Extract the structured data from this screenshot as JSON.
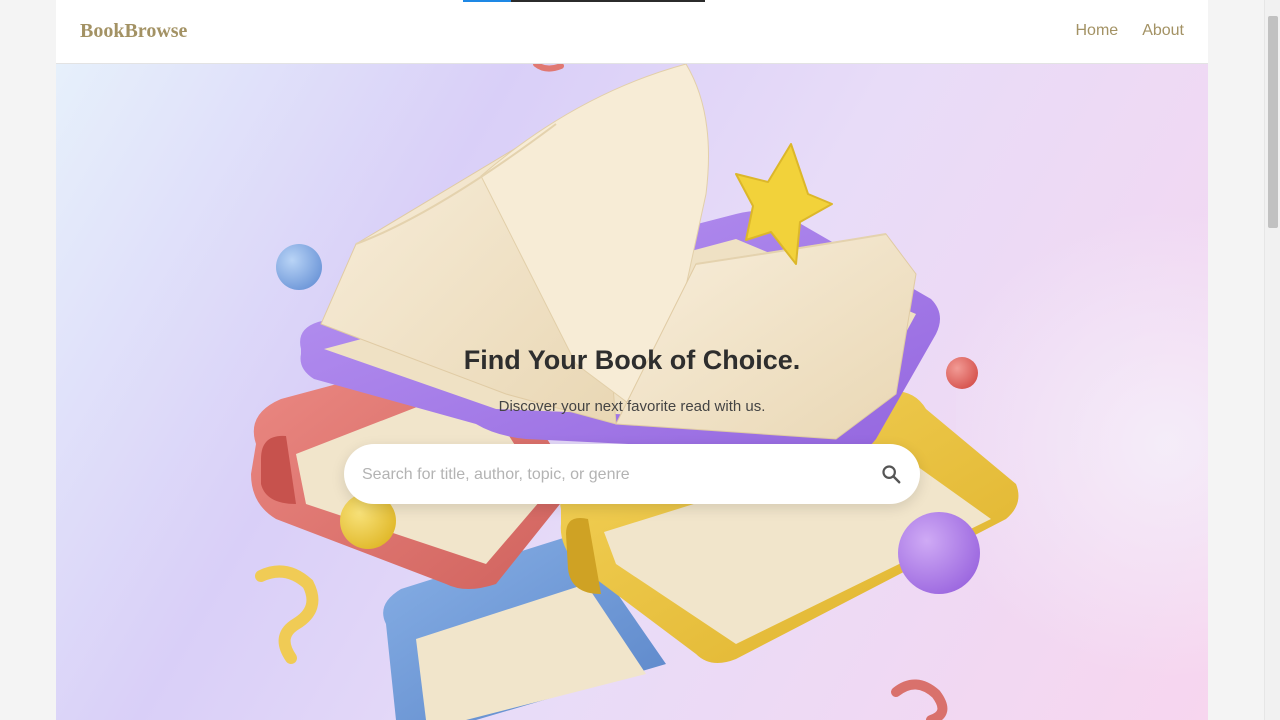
{
  "app": {
    "brand": "BookBrowse"
  },
  "nav": {
    "items": [
      {
        "label": "Home"
      },
      {
        "label": "About"
      }
    ]
  },
  "hero": {
    "title": "Find Your Book of Choice.",
    "subtitle": "Discover your next favorite read with us."
  },
  "search": {
    "placeholder": "Search for title, author, topic, or genre",
    "value": "",
    "icon": "search-icon"
  },
  "illustration": {
    "icon": "stacked-books-illustration",
    "colors": {
      "page": "#f3e6cc",
      "purple_cover": "#a97ee8",
      "red_cover": "#e07872",
      "yellow_cover": "#ecc53c",
      "blue_cover": "#6f9bd8",
      "star": "#f2d23a"
    }
  },
  "theme": {
    "brand_color": "#a39264",
    "title_color": "#2e2e2e"
  }
}
